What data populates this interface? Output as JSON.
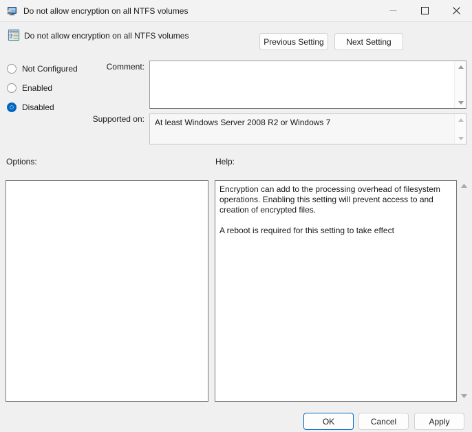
{
  "window": {
    "title": "Do not allow encryption on all NTFS volumes",
    "icon": "computer-policy-icon",
    "controls": {
      "minimize": "minimize-icon",
      "maximize": "maximize-icon",
      "close": "close-icon"
    }
  },
  "header": {
    "icon": "policy-setting-icon",
    "policy_name": "Do not allow encryption on all NTFS volumes",
    "previous_setting_label": "Previous Setting",
    "next_setting_label": "Next Setting"
  },
  "state": {
    "options": [
      {
        "label": "Not Configured",
        "selected": false
      },
      {
        "label": "Enabled",
        "selected": false
      },
      {
        "label": "Disabled",
        "selected": true
      }
    ],
    "selected_value": "Disabled"
  },
  "comment": {
    "label": "Comment:",
    "value": "",
    "scrollbar": {
      "up": "scroll-up-arrow-icon",
      "down": "scroll-down-arrow-icon"
    }
  },
  "supported_on": {
    "label": "Supported on:",
    "value": "At least Windows Server 2008 R2 or Windows 7",
    "scrollbar": {
      "up": "scroll-up-arrow-icon",
      "down": "scroll-down-arrow-icon"
    }
  },
  "options_section": {
    "label": "Options:",
    "content": ""
  },
  "help_section": {
    "label": "Help:",
    "paragraph_1": "Encryption can add to the processing overhead of filesystem operations.  Enabling this setting will prevent access to and creation of encrypted files.",
    "paragraph_2": "A reboot is required for this setting to take effect",
    "scrollbar": {
      "up": "scroll-up-arrow-icon",
      "down": "scroll-down-arrow-icon"
    }
  },
  "footer": {
    "ok_label": "OK",
    "cancel_label": "Cancel",
    "apply_label": "Apply"
  },
  "colors": {
    "accent": "#0067c0",
    "dialog_background": "#f0f0f0",
    "titlebar_background": "#f3f3f3",
    "panel_background": "#ffffff",
    "panel_border": "#767676"
  }
}
